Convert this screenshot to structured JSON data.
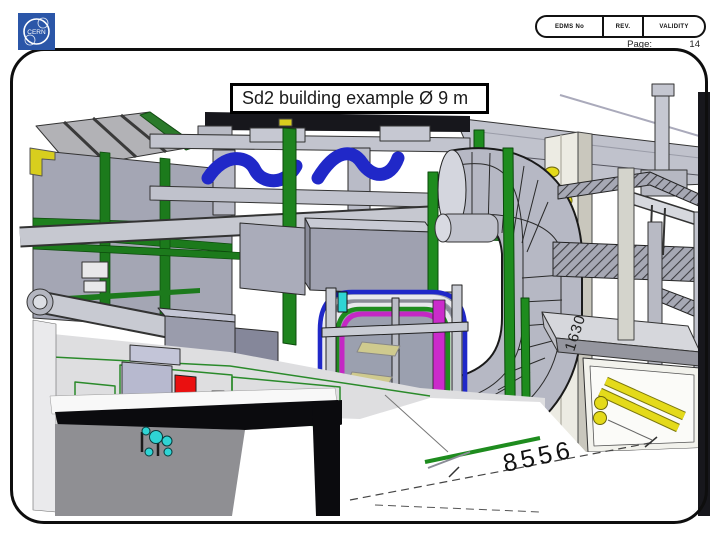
{
  "header": {
    "edms_label": "EDMS No",
    "rev_label": "REV.",
    "validity_label": "VALIDITY",
    "page_label": "Page:",
    "page_number": "14"
  },
  "logo": {
    "text": "CERN"
  },
  "slide": {
    "title": "Sd2 building example Ø 9 m"
  },
  "drawing": {
    "dimension_width": "8556",
    "dimension_depth": "1630"
  },
  "colors": {
    "logo_blue": "#2b56a8",
    "cad_green": "#1e801e",
    "duct_blue": "#2028c8",
    "cable_magenta": "#c428c4",
    "pipe_yellow": "#e4da1a",
    "alert_red": "#ea1010",
    "cyan_dot": "#2fd4d4",
    "cad_gray": "#b6b8c4"
  }
}
